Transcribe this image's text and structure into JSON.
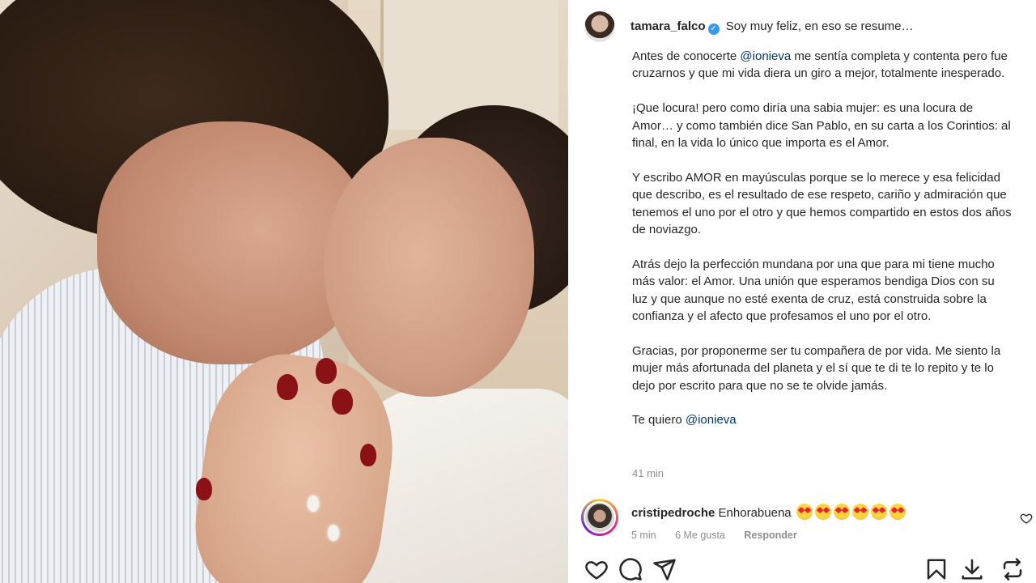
{
  "post": {
    "username": "tamara_falco",
    "verified_mark": "✓",
    "caption_lead": "Soy muy feliz, en eso se resume…",
    "paragraphs": {
      "p1_pre": "Antes de conocerte ",
      "p1_mention": "@ionieva",
      "p1_post": " me sentía completa y contenta pero fue cruzarnos y que mi vida diera un giro a mejor, totalmente inesperado.",
      "p2": "¡Que locura! pero como diría una sabia mujer: es una locura de Amor… y como también dice San Pablo, en su carta a los Corintios: al final, en la vida lo único que importa es el Amor.",
      "p3": "Y escribo AMOR en mayúsculas porque se lo merece y esa felicidad que describo, es el resultado de ese respeto, cariño y admiración que tenemos el uno por el otro y que hemos compartido en estos dos años de noviazgo.",
      "p4": "Atrás dejo la perfección mundana por una que para mi tiene mucho más valor: el Amor. Una unión que esperamos bendiga Dios con su luz y que aunque no esté exenta de cruz, está construida sobre la confianza y el afecto que profesamos el uno por el otro.",
      "p5": "Gracias, por proponerme ser tu compañera de por vida. Me siento la mujer más afortunada del planeta y el sí que te di te lo repito y te lo dejo por escrito para que no se te olvide jamás.",
      "p6_pre": "Te quiero ",
      "p6_mention": "@ionieva"
    },
    "timestamp": "41 min"
  },
  "comment": {
    "username": "cristipedroche",
    "text": "Enhorabuena",
    "emoji_name": "star-struck-emoji",
    "emoji_count": 6,
    "time": "5 min",
    "likes": "6 Me gusta",
    "reply_label": "Responder"
  },
  "actions": [
    "like-icon",
    "comment-icon",
    "share-icon",
    "save-icon",
    "download-icon",
    "repost-icon"
  ],
  "colors": {
    "mention": "#00376b",
    "verified": "#3897f0",
    "nail": "#8a1116"
  }
}
